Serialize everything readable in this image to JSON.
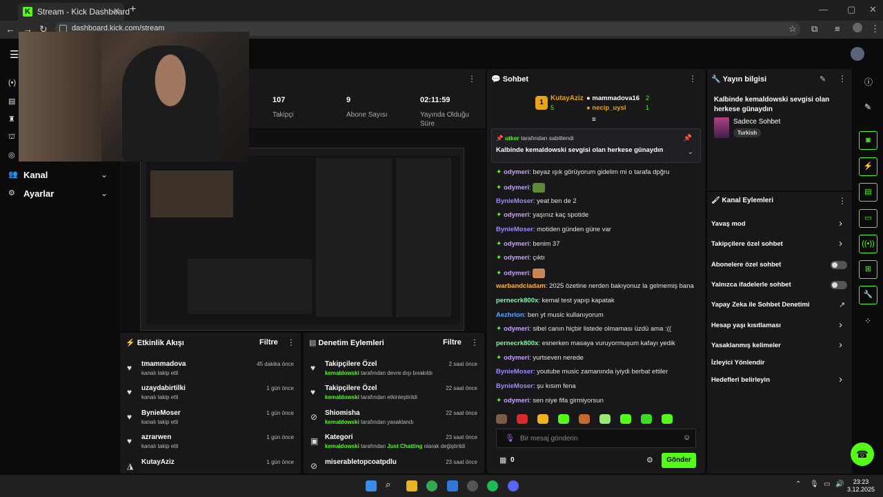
{
  "browser": {
    "tab_title": "Stream - Kick Dashboard",
    "url": "dashboard.kick.com/stream"
  },
  "sidebar": {
    "items": [
      {
        "label": "Kanal"
      },
      {
        "label": "Ayarlar"
      }
    ]
  },
  "stats": [
    {
      "value": "107",
      "label": "Takipçi"
    },
    {
      "value": "9",
      "label": "Abone Sayısı"
    },
    {
      "value": "02:11:59",
      "label": "Yayında Olduğu Süre"
    }
  ],
  "activity": {
    "title": "Etkinlik Akışı",
    "filter": "Filtre",
    "items": [
      {
        "name": "tmammadova",
        "sub": "kanalı takip etti",
        "time": "45 dakika önce",
        "icon": "heart-icon"
      },
      {
        "name": "uzaydabirtilki",
        "sub": "kanalı takip etti",
        "time": "1 gün önce",
        "icon": "heart-icon"
      },
      {
        "name": "BynieMoser",
        "sub": "kanalı takip etti",
        "time": "1 gün önce",
        "icon": "heart-icon"
      },
      {
        "name": "azrarwen",
        "sub": "kanalı takip etti",
        "time": "1 gün önce",
        "icon": "heart-icon"
      },
      {
        "name": "KutayAziz",
        "sub": "",
        "time": "1 gün önce",
        "icon": "kick-icon"
      }
    ]
  },
  "moderation": {
    "title": "Denetim Eylemleri",
    "filter": "Filtre",
    "items": [
      {
        "name": "Takipçilere Özel",
        "actor": "kemaldowski",
        "sub": "tarafından devre dışı bırakıldı",
        "time": "2 saat önce"
      },
      {
        "name": "Takipçilere Özel",
        "actor": "kemaldowski",
        "sub": "tarafından etkinleştirildi",
        "time": "22 saat önce"
      },
      {
        "name": "Shiomisha",
        "actor": "kemaldowski",
        "sub": "tarafından yasaklandı",
        "time": "22 saat önce"
      },
      {
        "name": "Kategori",
        "actor": "kemaldowski",
        "sub": "tarafından",
        "extra": "Just Chatting",
        "sub2": "olarak değiştirildi",
        "time": "23 saat önce"
      },
      {
        "name": "miserabletopcoatpdlu",
        "actor": "",
        "sub": "",
        "time": "23 saat önce"
      }
    ]
  },
  "chat": {
    "title": "Sohbet",
    "leaderboard": [
      {
        "rank": "1",
        "name": "KutayAziz",
        "count": "5"
      },
      {
        "name": "mammadova16",
        "count": "2"
      },
      {
        "name": "necip_uysl",
        "count": "1"
      }
    ],
    "pinned": {
      "by_user": "utker",
      "by_text": "tarafından sabitlendi",
      "text": "Kalbinde kemaldowski sevgisi olan herkese günaydın"
    },
    "messages": [
      {
        "user": "odymeri",
        "text": "beyaz ışık görüyorum gidelim mi o tarafa dpğru",
        "color": "#c9a4ff",
        "badge": true
      },
      {
        "user": "odymeri",
        "text": "",
        "color": "#c9a4ff",
        "badge": true
      },
      {
        "user": "BynieMoser",
        "text": "yeat ben de 2",
        "color": "#9b8cff",
        "badge": false
      },
      {
        "user": "odymeri",
        "text": "yaşınız kaç spotide",
        "color": "#c9a4ff",
        "badge": true
      },
      {
        "user": "BynieMoser",
        "text": "motiden günden güne var",
        "color": "#9b8cff",
        "badge": false
      },
      {
        "user": "odymeri",
        "text": "benim 37",
        "color": "#c9a4ff",
        "badge": true
      },
      {
        "user": "odymeri",
        "text": "çıktı",
        "color": "#c9a4ff",
        "badge": true
      },
      {
        "user": "odymeri",
        "text": "",
        "color": "#c9a4ff",
        "badge": true
      },
      {
        "user": "warbandciadam",
        "text": "2025 özetine nerden bakıyonuz la gelmemiş bana",
        "color": "#ffb43a",
        "badge": false
      },
      {
        "user": "pernecrk800x",
        "text": "kemal test yapıp kapatak",
        "color": "#7dffa0",
        "badge": false
      },
      {
        "user": "Aezhrion",
        "text": "ben yt music kullanıyorum",
        "color": "#63a8ff",
        "badge": false
      },
      {
        "user": "odymeri",
        "text": "sibel canın hiçbir listede olmaması üzdü ama :((",
        "color": "#c9a4ff",
        "badge": true
      },
      {
        "user": "pernecrk800x",
        "text": "esnerken masaya vuruyormuşum kafayı yedik",
        "color": "#7dffa0",
        "badge": false
      },
      {
        "user": "odymeri",
        "text": "yurtseven nerede",
        "color": "#c9a4ff",
        "badge": true
      },
      {
        "user": "BynieMoser",
        "text": "youtube music zamanında iyiydi berbat ettiler",
        "color": "#9b8cff",
        "badge": false
      },
      {
        "user": "BynieMoser",
        "text": "şu kısım fena",
        "color": "#9b8cff",
        "badge": false
      },
      {
        "user": "odymeri",
        "text": "sen niye fifa girmiyorsun",
        "color": "#c9a4ff",
        "badge": true
      }
    ],
    "input_placeholder": "Bir mesaj gönderin",
    "points": "0",
    "send": "Gönder"
  },
  "stream_info": {
    "title": "Yayın bilgisi",
    "stream_title": "Kalbinde kemaldowski sevgisi olan herkese günaydın",
    "category": "Sadece Sohbet",
    "tag": "Turkish"
  },
  "channel_actions": {
    "title": "Kanal Eylemleri",
    "items": [
      {
        "label": "Yavaş mod",
        "control": "arrow"
      },
      {
        "label": "Takipçilere özel sohbet",
        "control": "arrow"
      },
      {
        "label": "Abonelere özel sohbet",
        "control": "toggle"
      },
      {
        "label": "Yalnızca ifadelerle sohbet",
        "control": "toggle"
      },
      {
        "label": "Yapay Zeka ile Sohbet Denetimi",
        "control": "external"
      },
      {
        "label": "Hesap yaşı kısıtlaması",
        "control": "arrow"
      },
      {
        "label": "Yasaklanmış kelimeler",
        "control": "arrow"
      },
      {
        "label": "İzleyici Yönlendir",
        "control": "none"
      },
      {
        "label": "Hedefleri belirleyin",
        "control": "arrow"
      }
    ]
  },
  "taskbar": {
    "time": "23:23",
    "date": "3.12.2025"
  },
  "colors": {
    "accent": "#53fc18",
    "panel": "#18181b",
    "background": "#0b0b0c"
  }
}
